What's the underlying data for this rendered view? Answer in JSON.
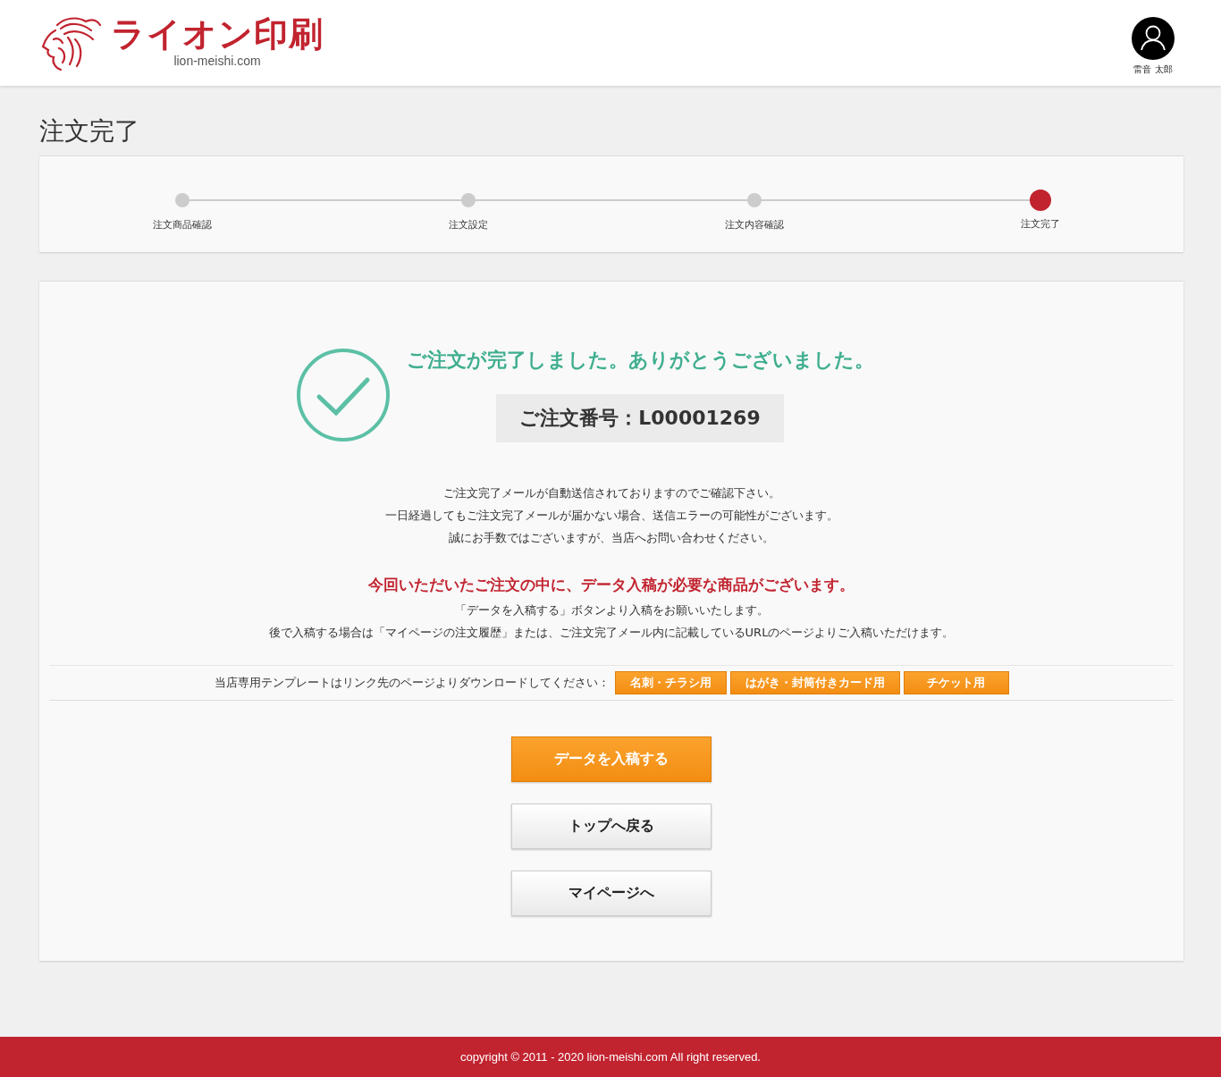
{
  "header": {
    "logo_text": "ライオン印刷",
    "logo_domain": "lion-meishi.com",
    "user_name": "雷音 太郎"
  },
  "page_title": "注文完了",
  "steps": [
    {
      "label": "注文商品確認",
      "selected": false
    },
    {
      "label": "注文設定",
      "selected": false
    },
    {
      "label": "注文内容確認",
      "selected": false
    },
    {
      "label": "注文完了",
      "selected": true
    }
  ],
  "completion": {
    "heading": "ご注文が完了しました。ありがとうございました。",
    "order_number": "ご注文番号：L00001269",
    "notes": [
      "ご注文完了メールが自動送信されておりますのでご確認下さい。",
      "一日経過してもご注文完了メールが届かない場合、送信エラーの可能性がございます。",
      "誠にお手数ではございますが、当店へお問い合わせください。"
    ],
    "alert": "今回いただいたご注文の中に、データ入稿が必要な商品がございます。",
    "alert_notes": [
      "「データを入稿する」ボタンより入稿をお願いいたします。",
      "後で入稿する場合は「マイページの注文履歴」または、ご注文完了メール内に記載しているURLのページよりご入稿いただけます。"
    ]
  },
  "templates": {
    "label": "当店専用テンプレートはリンク先のページよりダウンロードしてください：",
    "links": [
      "名刺・チラシ用",
      "はがき・封筒付きカード用",
      "チケット用"
    ]
  },
  "buttons": [
    {
      "label": "データを入稿する",
      "kind": "primary"
    },
    {
      "label": "トップへ戻る",
      "kind": "secondary"
    },
    {
      "label": "マイページへ",
      "kind": "secondary"
    }
  ],
  "footer": "copyright © 2011 - 2020 lion-meishi.com All right reserved."
}
